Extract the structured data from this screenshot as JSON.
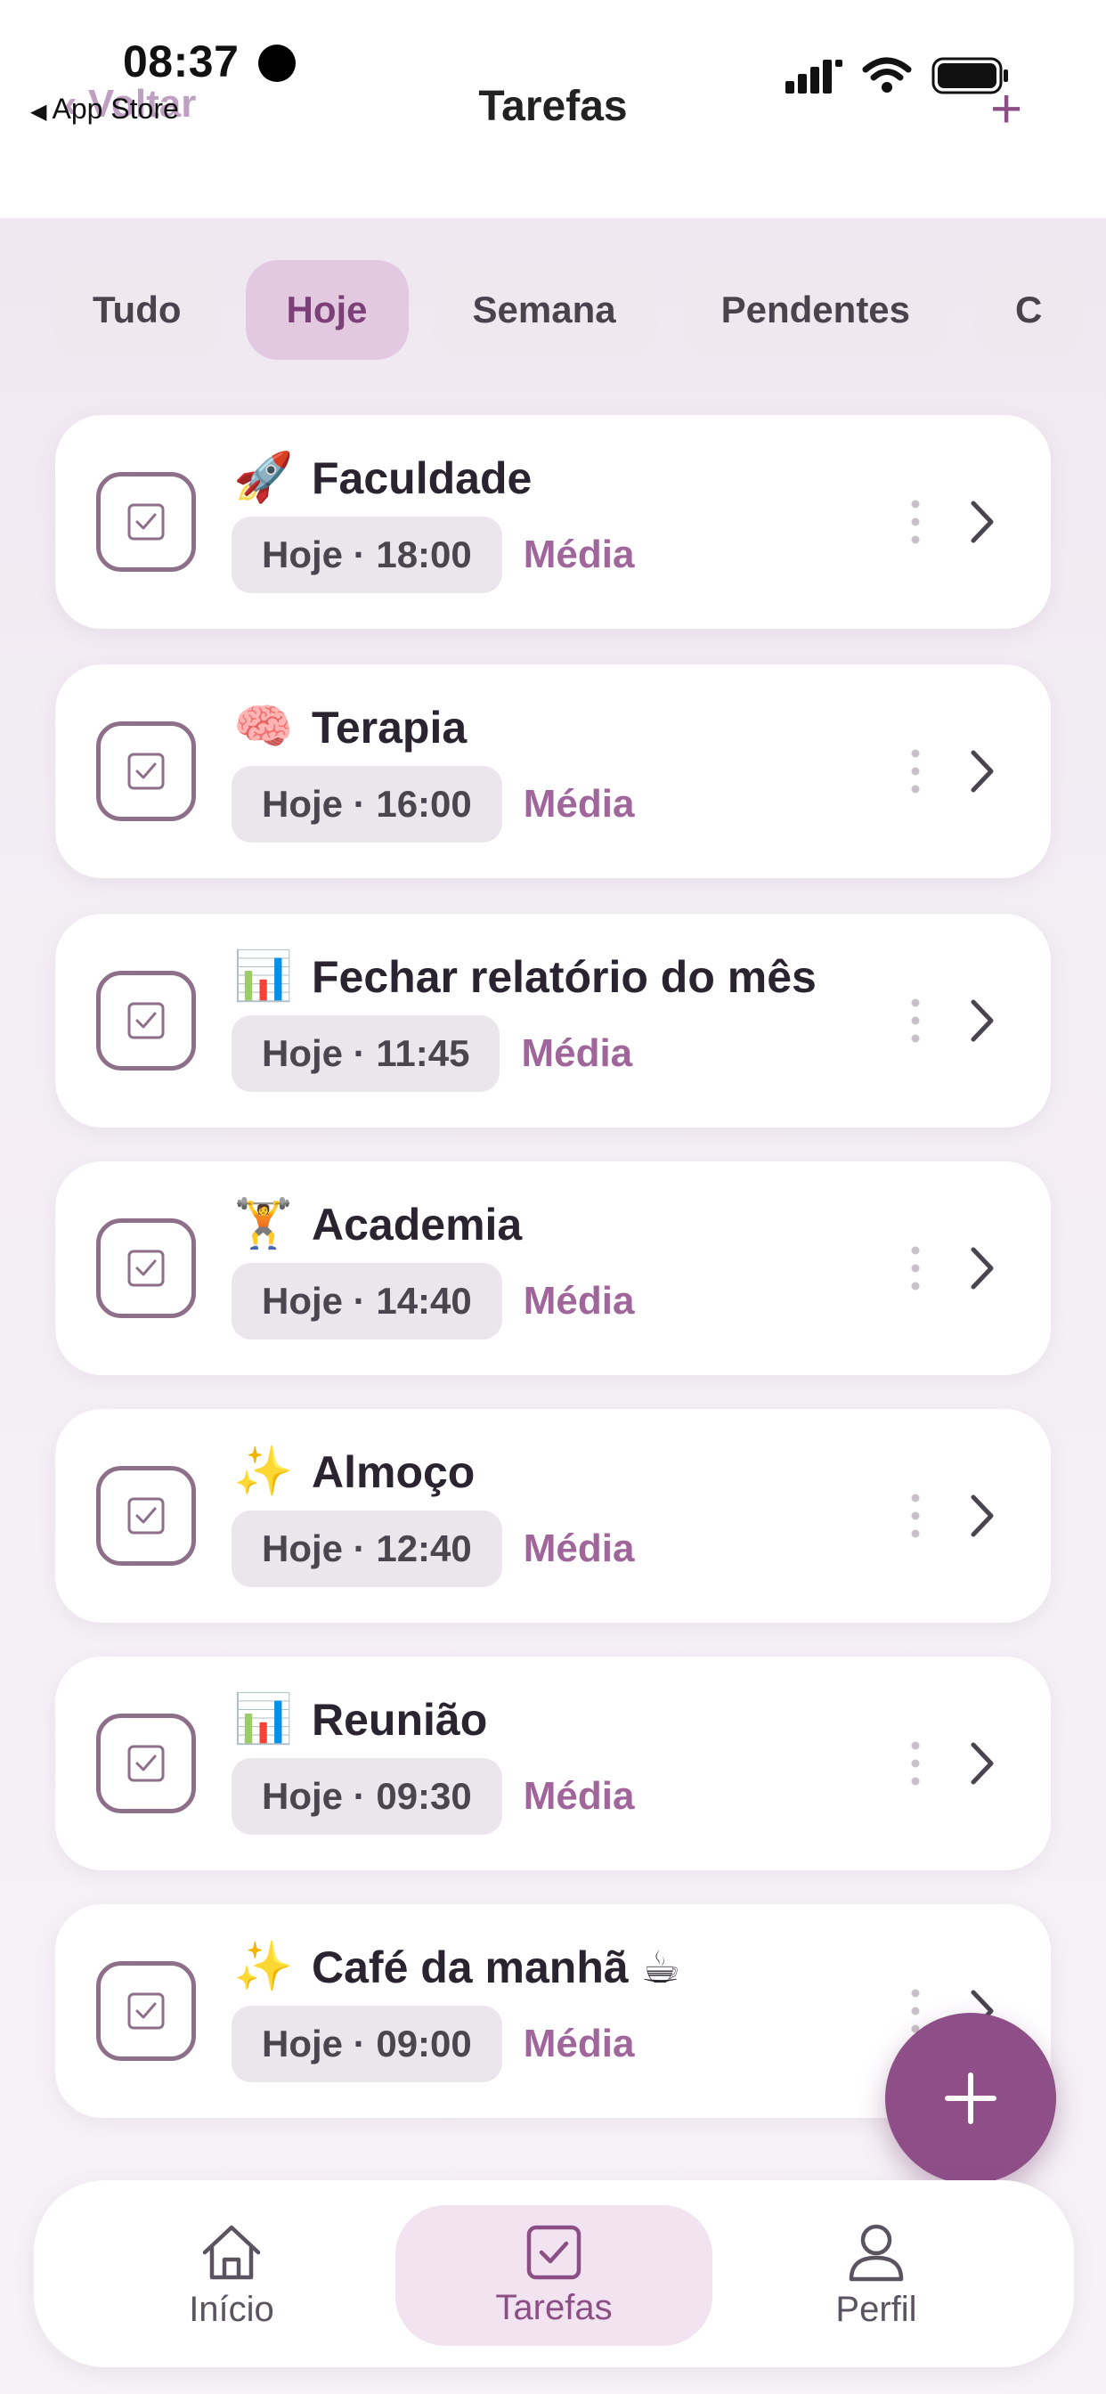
{
  "status_bar": {
    "time": "08:37",
    "back_app": "App Store"
  },
  "nav": {
    "back_label": "Voltar",
    "title": "Tarefas",
    "add_label": "+"
  },
  "filters": [
    {
      "label": "Tudo",
      "active": false
    },
    {
      "label": "Hoje",
      "active": true
    },
    {
      "label": "Semana",
      "active": false
    },
    {
      "label": "Pendentes",
      "active": false
    },
    {
      "label": "C",
      "active": false
    }
  ],
  "tasks": [
    {
      "emoji": "🚀",
      "title": "Faculdade",
      "when": "Hoje · 18:00",
      "priority": "Média"
    },
    {
      "emoji": "🧠",
      "title": "Terapia",
      "when": "Hoje · 16:00",
      "priority": "Média"
    },
    {
      "emoji": "📊",
      "title": "Fechar relatório do mês",
      "when": "Hoje · 11:45",
      "priority": "Média"
    },
    {
      "emoji": "🏋️",
      "title": "Academia",
      "when": "Hoje · 14:40",
      "priority": "Média"
    },
    {
      "emoji": "✨",
      "title": "Almoço",
      "when": "Hoje · 12:40",
      "priority": "Média"
    },
    {
      "emoji": "📊",
      "title": "Reunião",
      "when": "Hoje · 09:30",
      "priority": "Média"
    },
    {
      "emoji": "✨",
      "title": "Café da manhã ☕",
      "when": "Hoje · 09:00",
      "priority": "Média"
    }
  ],
  "tabbar": {
    "home_label": "Início",
    "tasks_label": "Tarefas",
    "profile_label": "Perfil",
    "active": "Tarefas"
  },
  "colors": {
    "accent": "#8e4f88",
    "chip_active_bg": "#e2c9e0",
    "priority": "#a0659a"
  }
}
